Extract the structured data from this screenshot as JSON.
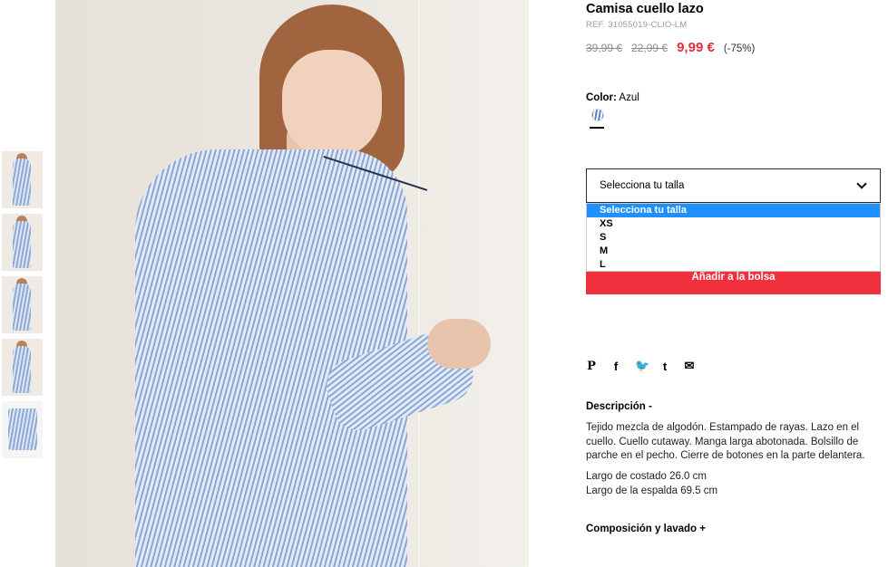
{
  "thumbnails": [
    {
      "label": "thumbnail-1"
    },
    {
      "label": "thumbnail-2"
    },
    {
      "label": "thumbnail-3"
    },
    {
      "label": "thumbnail-4"
    },
    {
      "label": "thumbnail-5"
    }
  ],
  "product": {
    "title": "Camisa cuello lazo",
    "ref": "REF. 31055019-CLIO-LM",
    "price_old_1": "39,99 €",
    "price_old_2": "22,99 €",
    "price_now": "9,99 €",
    "discount": "(-75%)"
  },
  "color": {
    "label": "Color:",
    "value": "Azul"
  },
  "size_select": {
    "selected": "Selecciona tu talla",
    "options": [
      "Selecciona tu talla",
      "XS",
      "S",
      "M",
      "L"
    ]
  },
  "cart": {
    "add_label": "Añadir a la bolsa"
  },
  "share": {
    "pinterest": "P",
    "facebook": "f",
    "twitter": "🐦",
    "tumblr": "t",
    "email": "✉"
  },
  "description": {
    "title": "Descripción -",
    "text": "Tejido mezcla de algodón. Estampado de rayas. Lazo en el cuello. Cuello cutaway. Manga larga abotonada. Bolsillo de parche en el pecho. Cierre de botones en la parte delantera.",
    "measure_1": "Largo de costado 26.0 cm",
    "measure_2": "Largo de la espalda 69.5 cm"
  },
  "composition": {
    "title": "Composición y lavado +"
  },
  "colors": {
    "accent_red": "#f0303d",
    "price_red": "#e3313a",
    "select_highlight": "#1e90ff"
  }
}
